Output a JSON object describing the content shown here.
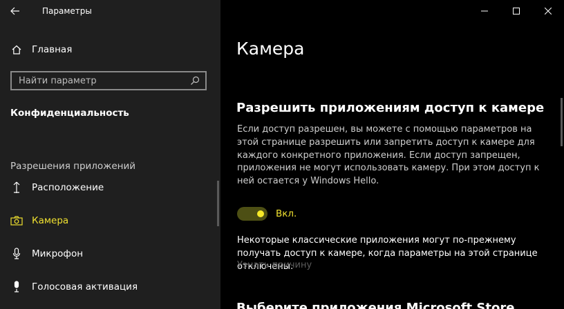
{
  "window": {
    "app_title": "Параметры",
    "controls": {
      "minimize_glyph": "—",
      "maximize_glyph": "☐",
      "close_glyph": "✕"
    }
  },
  "sidebar": {
    "home_label": "Главная",
    "search": {
      "placeholder": "Найти параметр",
      "value": ""
    },
    "section_title": "Конфиденциальность",
    "group_header": "Разрешения приложений",
    "items": [
      {
        "label": "Расположение",
        "icon": "location-icon",
        "active": false
      },
      {
        "label": "Камера",
        "icon": "camera-icon",
        "active": true
      },
      {
        "label": "Микрофон",
        "icon": "microphone-icon",
        "active": false
      },
      {
        "label": "Голосовая активация",
        "icon": "voice-activation-icon",
        "active": false
      }
    ]
  },
  "main": {
    "page_title": "Камера",
    "section_title": "Разрешить приложениям доступ к камере",
    "description": "Если доступ разрешен, вы можете с помощью параметров на этой странице разрешить или запретить доступ к камере для каждого конкретного приложения. Если доступ запрещен, приложения не могут использовать камеру. При этом доступ к ней остается у Windows Hello.",
    "toggle": {
      "state": "on",
      "label": "Вкл."
    },
    "note": "Некоторые классические приложения могут по-прежнему получать доступ к камере, когда параметры на этой странице отключены.",
    "learn_more": "Узнать причину",
    "next_section_title": "Выберите приложения Microsoft Store"
  },
  "colors": {
    "accent": "#f0e130",
    "sidebar_bg": "#1f1f1f",
    "main_bg": "#000000",
    "toggle_track": "#4d4f14"
  }
}
